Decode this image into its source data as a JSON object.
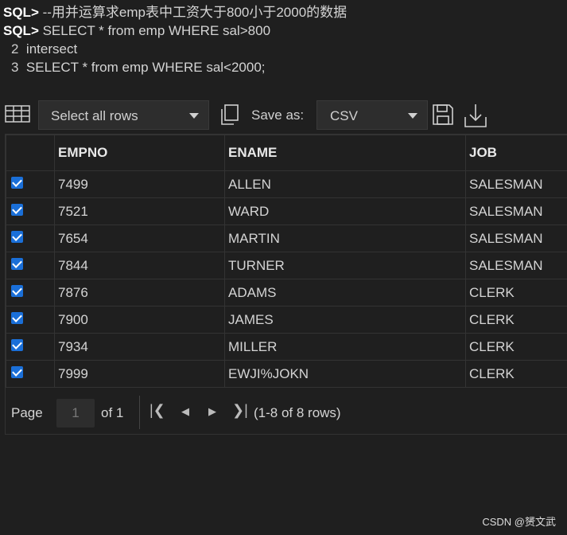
{
  "sql": {
    "prompt": "SQL>",
    "lines": [
      {
        "prompt": "SQL>",
        "text": " --用并运算求emp表中工资大于800小于2000的数据"
      },
      {
        "prompt": "SQL>",
        "text": " SELECT * from emp WHERE sal>800"
      },
      {
        "num": "2",
        "text": "  intersect"
      },
      {
        "num": "3",
        "text": "  SELECT * from emp WHERE sal<2000;"
      }
    ]
  },
  "toolbar": {
    "select_value": "Select all rows",
    "save_as_label": "Save as:",
    "format_value": "CSV",
    "icons": [
      "grid-icon",
      "copy-icon",
      "save-icon",
      "download-icon"
    ]
  },
  "grid": {
    "columns": [
      "EMPNO",
      "ENAME",
      "JOB"
    ],
    "rows": [
      {
        "checked": true,
        "empno": "7499",
        "ename": "ALLEN",
        "job": "SALESMAN"
      },
      {
        "checked": true,
        "empno": "7521",
        "ename": "WARD",
        "job": "SALESMAN"
      },
      {
        "checked": true,
        "empno": "7654",
        "ename": "MARTIN",
        "job": "SALESMAN"
      },
      {
        "checked": true,
        "empno": "7844",
        "ename": "TURNER",
        "job": "SALESMAN"
      },
      {
        "checked": true,
        "empno": "7876",
        "ename": "ADAMS",
        "job": "CLERK"
      },
      {
        "checked": true,
        "empno": "7900",
        "ename": "JAMES",
        "job": "CLERK"
      },
      {
        "checked": true,
        "empno": "7934",
        "ename": "MILLER",
        "job": "CLERK"
      },
      {
        "checked": true,
        "empno": "7999",
        "ename": "EWJI%JOKN",
        "job": "CLERK"
      }
    ]
  },
  "pager": {
    "page_label": "Page",
    "page_value": "1",
    "of_label": "of 1",
    "count_text": "(1-8 of 8 rows)"
  },
  "watermark": "CSDN @赟文武",
  "colors": {
    "background": "#1f1f1f",
    "checkbox": "#1a6fd8"
  }
}
